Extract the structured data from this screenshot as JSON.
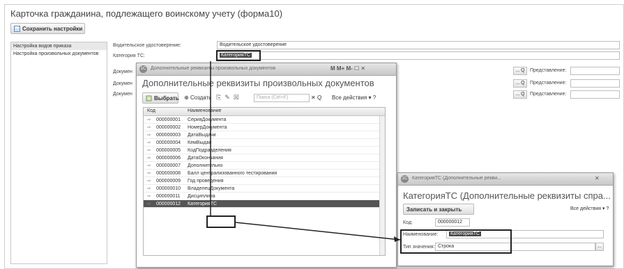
{
  "page": {
    "title": "Карточка гражданина, подлежащего воинскому учету (форма10)",
    "save_settings": "Сохранить настройки"
  },
  "left_list": {
    "items": [
      "Настройка видов приказа",
      "Настройка произвольных документов"
    ]
  },
  "form": {
    "driver_license_label": "Водительское удостоверение:",
    "driver_license_value": "Водительское удостоверение",
    "category_label": "Категория ТС:",
    "category_value": "КатегорияТС",
    "doc_label_1": "Докумен",
    "doc_label_2": "Докумен",
    "doc_label_3": "Докумен",
    "representation_label": "Представление:",
    "search_symbol": "... Q"
  },
  "dialog1": {
    "titlebar": "Дополнительные реквизиты произвольных документов",
    "controls": "M  M+  M-  ☐  ✕",
    "heading": "Дополнительные реквизиты произвольных документов",
    "select_btn": "Выбрать",
    "create_btn": "Создать",
    "search_placeholder": "Поиск (Ctrl+F)",
    "all_actions": "Все действия",
    "col_code": "Код",
    "col_name": "Наименование",
    "rows": [
      {
        "code": "000000001",
        "name": "СерияДокумента"
      },
      {
        "code": "000000002",
        "name": "НомерДокумента"
      },
      {
        "code": "000000003",
        "name": "ДатаВыдачи"
      },
      {
        "code": "000000004",
        "name": "КемВыдан"
      },
      {
        "code": "000000005",
        "name": "КодПодразделения"
      },
      {
        "code": "000000006",
        "name": "ДатаОкончания"
      },
      {
        "code": "000000007",
        "name": "Дополнительно"
      },
      {
        "code": "000000008",
        "name": "Балл централизованного тестирования"
      },
      {
        "code": "000000009",
        "name": "Год проведения"
      },
      {
        "code": "000000010",
        "name": "ВладелецДокумента"
      },
      {
        "code": "000000011",
        "name": "Дисциплина"
      },
      {
        "code": "000000012",
        "name": "КатегорияТС"
      }
    ]
  },
  "dialog2": {
    "titlebar": "КатегорияТС (Дополнительные рекви...",
    "heading": "КатегорияТС (Дополнительные реквизиты спра...",
    "write_close": "Записать и закрыть",
    "all_actions": "Все действия",
    "code_label": "Код:",
    "code_value": "000000012",
    "name_label": "Наименование:",
    "name_value": "КатегорияТС",
    "type_label": "Тип значения:",
    "type_value": "Строка"
  }
}
